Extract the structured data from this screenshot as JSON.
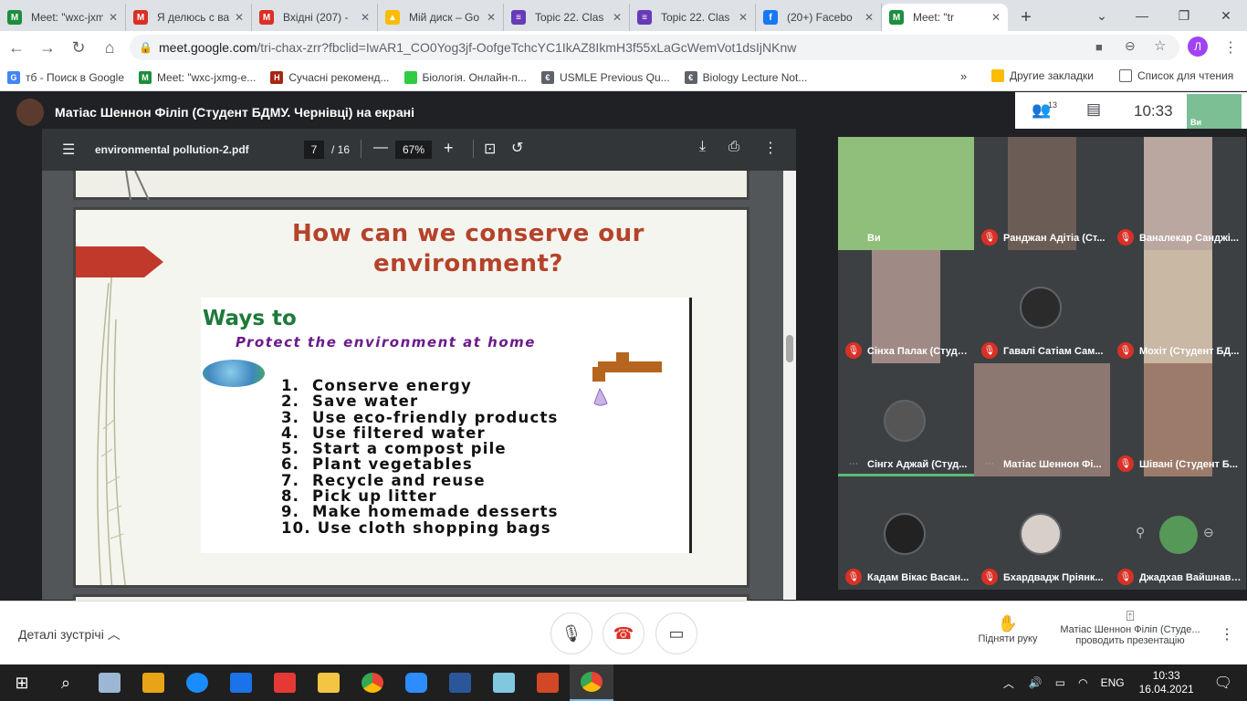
{
  "browser": {
    "tabs": [
      {
        "title": "Meet: \"wxc-jxmg",
        "color": "#1e8e3e",
        "glyph": "M",
        "active": false
      },
      {
        "title": "Я делюсь с ва",
        "color": "#d93025",
        "glyph": "M",
        "active": false
      },
      {
        "title": "Вхідні (207) -",
        "color": "#d93025",
        "glyph": "M",
        "active": false
      },
      {
        "title": "Мій диск – Go",
        "color": "#fbbc04",
        "glyph": "▲",
        "active": false
      },
      {
        "title": "Topic 22. Clas",
        "color": "#673ab7",
        "glyph": "≡",
        "active": false
      },
      {
        "title": "Topic 22. Clas",
        "color": "#673ab7",
        "glyph": "≡",
        "active": false
      },
      {
        "title": "(20+) Facebo",
        "color": "#1877f2",
        "glyph": "f",
        "active": false
      },
      {
        "title": "Meet: \"tr",
        "color": "#1e8e3e",
        "glyph": "M",
        "active": true
      }
    ],
    "url_host": "meet.google.com",
    "url_path": "/tri-chax-zrr?fbclid=IwAR1_CO0Yog3jf-OofgeTchcYC1IkAZ8IkmH3f55xLaGcWemVot1dsIjNKnw",
    "profile_initial": "Л",
    "bookmarks": [
      {
        "label": "тб - Поиск в Google",
        "color": "#4285f4",
        "glyph": "G"
      },
      {
        "label": "Meet: \"wxc-jxmg-e...",
        "color": "#1e8e3e",
        "glyph": "M"
      },
      {
        "label": "Сучасні рекоменд...",
        "color": "#a52714",
        "glyph": "H"
      },
      {
        "label": "Біологія. Онлайн-п...",
        "color": "#2ecc40",
        "glyph": ""
      },
      {
        "label": "USMLE Previous Qu...",
        "color": "#5f6368",
        "glyph": "€"
      },
      {
        "label": "Biology Lecture Not...",
        "color": "#5f6368",
        "glyph": "€"
      }
    ],
    "other_bookmarks": "Другие закладки",
    "reading_list": "Список для чтения"
  },
  "meet": {
    "presenter_title": "Матіас Шеннон Філіп (Студент БДМУ. Чернівці) на екрані",
    "participants_count": "13",
    "clock": "10:33",
    "self_label": "Ви",
    "participants": [
      {
        "name": "Ви",
        "muted": false,
        "bg": "#8fbf7a"
      },
      {
        "name": "Ранджан Адітіа (Ст...",
        "muted": true,
        "bg": "#6b5d55"
      },
      {
        "name": "Ваналекар Санджі...",
        "muted": true,
        "bg": "#b9a7a0"
      },
      {
        "name": "Сінха Палак (Студе...",
        "muted": true,
        "bg": "#a08a86"
      },
      {
        "name": "Гавалі Сатіам Сам...",
        "muted": true,
        "bg": "#2b2b2b"
      },
      {
        "name": "Мохіт (Студент БД...",
        "muted": true,
        "bg": "#c8b8a4"
      },
      {
        "name": "Сінгх Аджай (Студ...",
        "muted": false,
        "bg": "#555"
      },
      {
        "name": "Матіас Шеннон Фі...",
        "muted": false,
        "bg": "#8c7870"
      },
      {
        "name": "Шівані (Студент Б...",
        "muted": true,
        "bg": "#9c7b6a"
      },
      {
        "name": "Кадам Вікас Васан...",
        "muted": true,
        "bg": "#222"
      },
      {
        "name": "Бхардвадж Пріянк...",
        "muted": true,
        "bg": "#d8cfc8"
      },
      {
        "name": "Джадхав Вайшнаві ...",
        "muted": true,
        "bg": "#3c4043"
      }
    ],
    "meeting_details": "Деталі зустрічі",
    "raise_hand": "Підняти руку",
    "presenting_line1": "Матіас Шеннон Філіп (Студе...",
    "presenting_line2": "проводить презентацію"
  },
  "pdf": {
    "filename": "environmental pollution-2.pdf",
    "page_current": "7",
    "page_total": "/ 16",
    "zoom": "67%",
    "slide": {
      "title_line1": "How can we conserve our",
      "title_line2": "environment?",
      "ways_to": "Ways to",
      "protect": "Protect the environment at home",
      "items": [
        "1.  Conserve energy",
        "2.  Save water",
        "3.  Use eco-friendly products",
        "4.  Use filtered water",
        "5.  Start a compost pile",
        "6.  Plant vegetables",
        "7.  Recycle and reuse",
        "8.  Pick up litter",
        "9.  Make homemade desserts",
        "10. Use cloth shopping bags"
      ]
    }
  },
  "taskbar": {
    "lang": "ENG",
    "time": "10:33",
    "date": "16.04.2021"
  }
}
